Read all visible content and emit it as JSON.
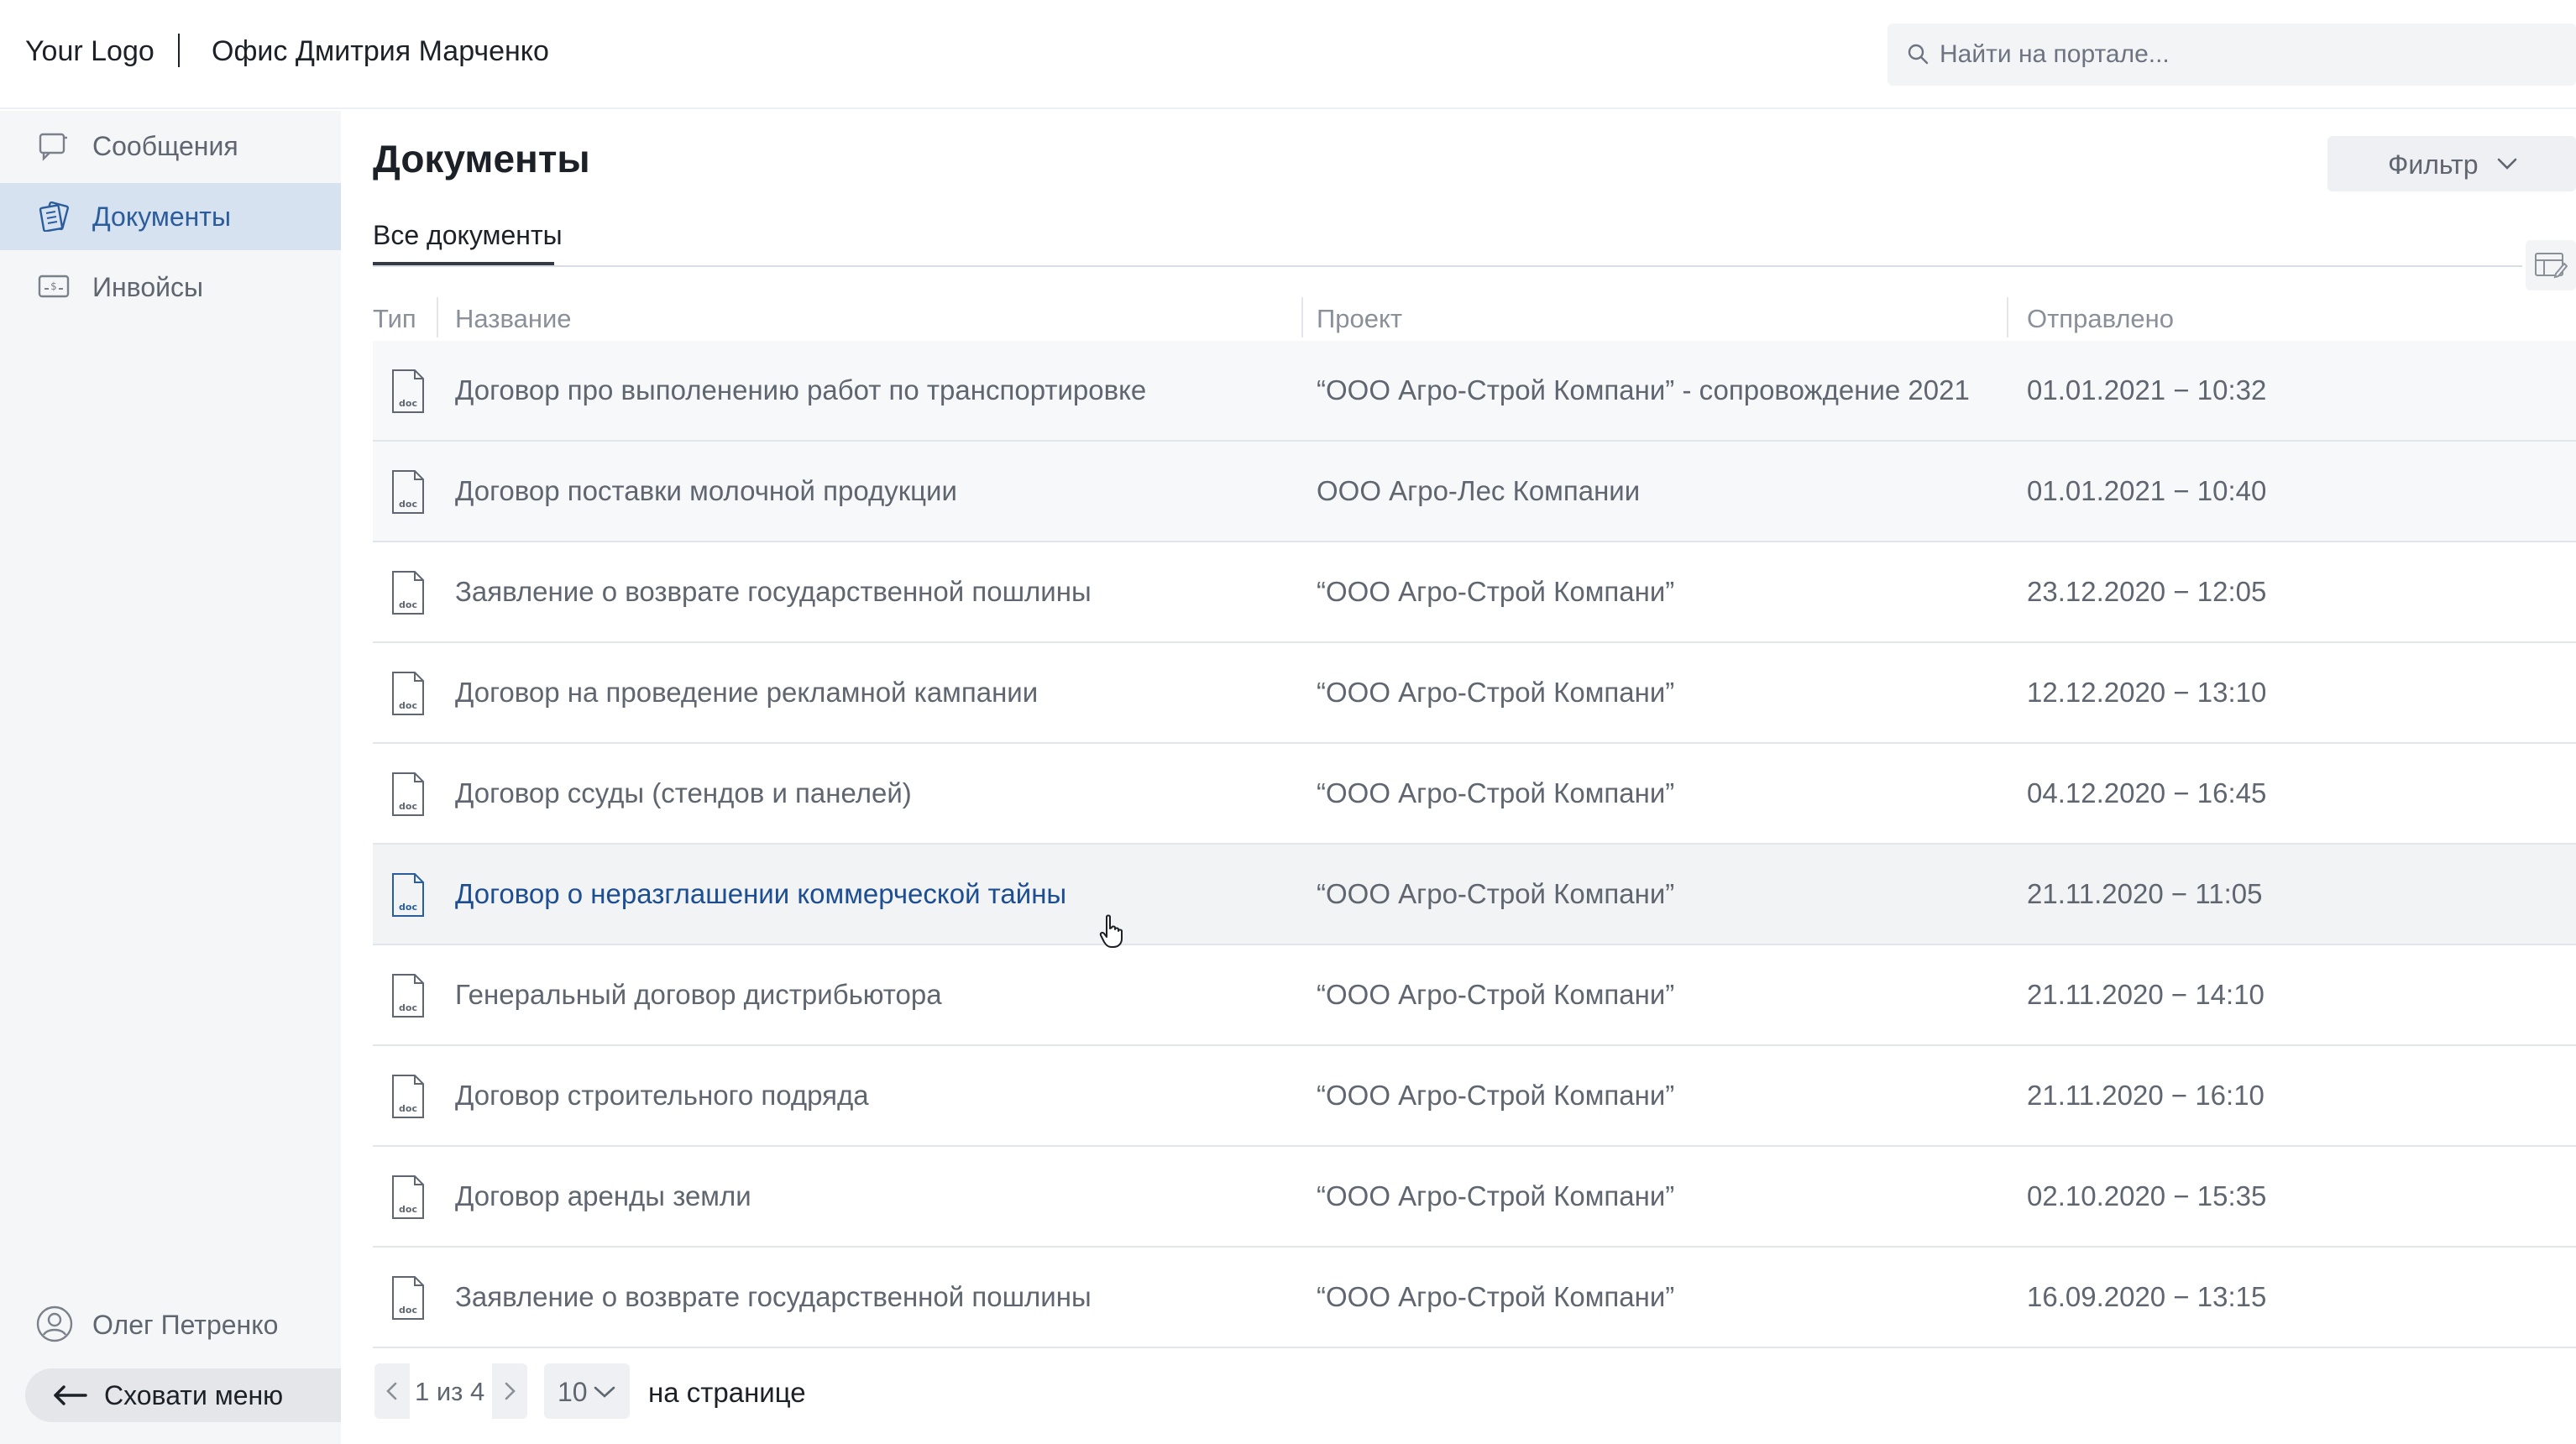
{
  "header": {
    "logo": "Your Logo",
    "office_title": "Офис Дмитрия Марченко",
    "search_placeholder": "Найти на портале..."
  },
  "sidebar": {
    "items": [
      {
        "label": "Сообщения",
        "icon": "messages-icon",
        "active": false
      },
      {
        "label": "Документы",
        "icon": "documents-icon",
        "active": true
      },
      {
        "label": "Инвойсы",
        "icon": "invoices-icon",
        "active": false
      }
    ],
    "user_name": "Олег Петренко",
    "hide_menu_label": "Сховати меню"
  },
  "main": {
    "title": "Документы",
    "filter_label": "Фильтр",
    "tab_label": "Все документы",
    "columns": {
      "type": "Тип",
      "name": "Название",
      "project": "Проект",
      "sent": "Отправлено"
    },
    "rows": [
      {
        "icon": "doc-file-icon",
        "name": "Договор про выполенению работ по транспортировке",
        "project": "“ООО Агро-Строй Компани” - сопровождение 2021",
        "sent": "01.01.2021 − 10:32"
      },
      {
        "icon": "doc-file-icon",
        "name": "Договор поставки молочной продукции",
        "project": "ООО Агро-Лес Компании",
        "sent": "01.01.2021 − 10:40"
      },
      {
        "icon": "doc-file-icon",
        "name": "Заявление о возврате государственной пошлины",
        "project": "“ООО Агро-Строй Компани”",
        "sent": "23.12.2020 − 12:05"
      },
      {
        "icon": "doc-file-icon",
        "name": "Договор на проведение рекламной кампании",
        "project": "“ООО Агро-Строй Компани”",
        "sent": "12.12.2020 − 13:10"
      },
      {
        "icon": "doc-file-icon",
        "name": "Договор ссуды (стендов и панелей)",
        "project": "“ООО Агро-Строй Компани”",
        "sent": "04.12.2020 − 16:45"
      },
      {
        "icon": "doc-file-icon",
        "name": "Договор о неразглашении коммерческой тайны",
        "project": "“ООО Агро-Строй Компани”",
        "sent": "21.11.2020 − 11:05"
      },
      {
        "icon": "doc-file-icon",
        "name": "Генеральный договор дистрибьютора",
        "project": "“ООО Агро-Строй Компани”",
        "sent": "21.11.2020 − 14:10"
      },
      {
        "icon": "doc-file-icon",
        "name": "Договор строительного подряда",
        "project": "“ООО Агро-Строй Компани”",
        "sent": "21.11.2020 − 16:10"
      },
      {
        "icon": "doc-file-icon",
        "name": "Договор аренды земли",
        "project": "“ООО Агро-Строй Компани”",
        "sent": "02.10.2020 − 15:35"
      },
      {
        "icon": "doc-file-icon",
        "name": "Заявление о возврате государственной пошлины",
        "project": "“ООО Агро-Строй Компани”",
        "sent": "16.09.2020 − 13:15"
      }
    ]
  },
  "pagination": {
    "page_text": "1 из 4",
    "per_page_value": "10",
    "per_page_label": "на странице"
  },
  "colors": {
    "accent": "#2b5d9c",
    "sidebar_bg": "#f5f6f8",
    "sidebar_active_bg": "#d7e2f0",
    "link_hover": "#1d4e92"
  }
}
